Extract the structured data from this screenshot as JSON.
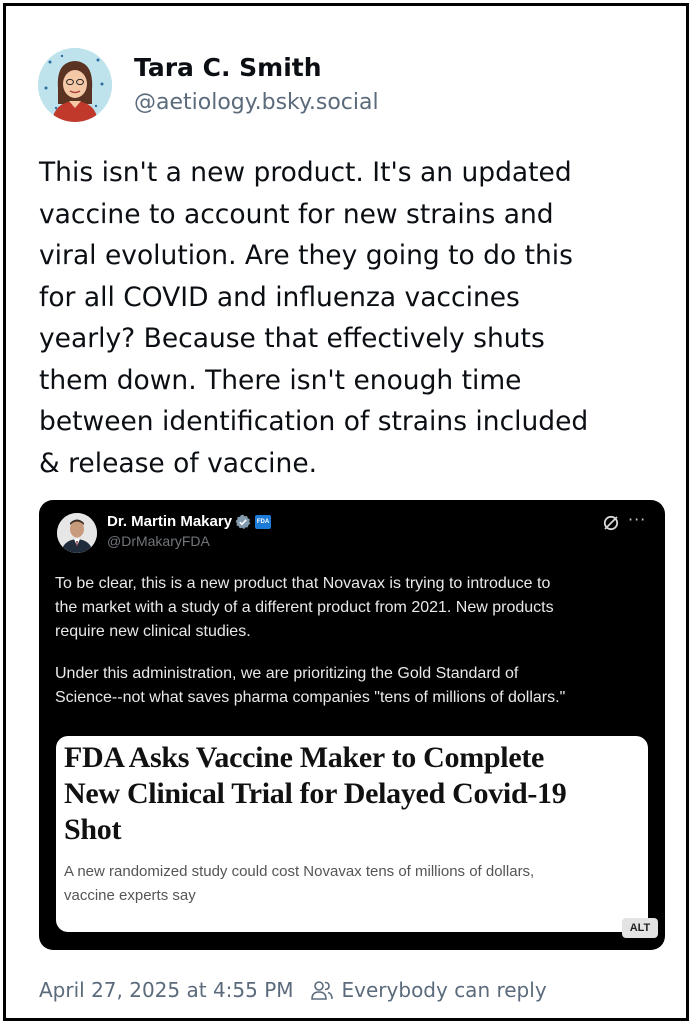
{
  "post": {
    "author_name": "Tara C. Smith",
    "author_handle": "@aetiology.bsky.social",
    "text_lines": [
      "This isn't a new product. It's an updated",
      "vaccine to account for new strains and",
      "viral evolution. Are they going to do this",
      "for all COVID and influenza vaccines",
      "yearly? Because that effectively shuts",
      "them down. There isn't enough time",
      "between identification of strains included",
      "& release of vaccine."
    ],
    "timestamp": "April 27, 2025 at 4:55 PM",
    "reply_setting": "Everybody can reply"
  },
  "embed": {
    "author_name": "Dr. Martin Makary",
    "author_handle": "@DrMakaryFDA",
    "gov_badge": "FDA",
    "paragraph1_lines": [
      "To be clear, this is a new product that Novavax is trying to introduce to",
      "the market with a study of a different product from 2021. New products",
      "require new clinical studies."
    ],
    "paragraph2_lines": [
      "Under this administration, we are prioritizing the Gold Standard of",
      "Science--not what saves pharma companies \"tens of millions of dollars.\""
    ],
    "article": {
      "headline_lines": [
        "FDA Asks Vaccine Maker to Complete",
        "New Clinical Trial for Delayed Covid-19",
        "Shot"
      ],
      "dek_lines": [
        "A new randomized study could cost Novavax tens of millions of dollars,",
        "vaccine experts say"
      ]
    },
    "alt_label": "ALT"
  },
  "icons": {
    "verified": "verified-badge-icon",
    "grok": "grok-icon",
    "more": "more-icon",
    "reply_setting": "people-icon"
  },
  "colors": {
    "secondary_text": "#5b6b7c",
    "verified_blue": "#1d9bf0",
    "embed_background": "#000000"
  }
}
